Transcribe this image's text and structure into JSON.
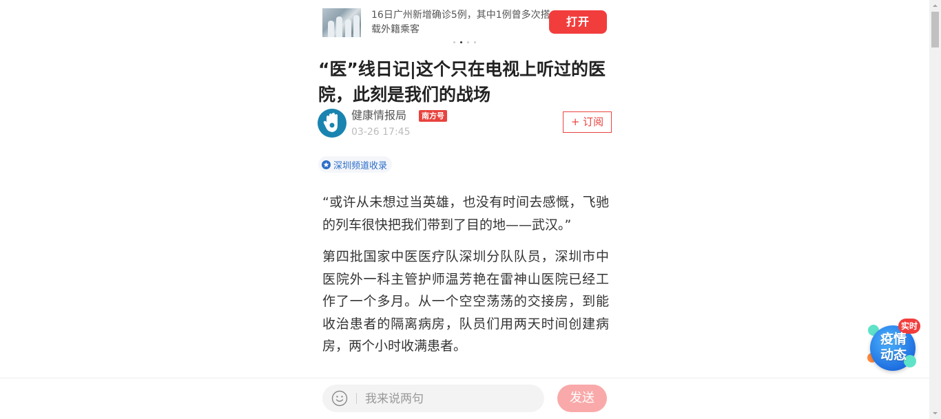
{
  "banner": {
    "text": "16日广州新增确诊5例，其中1例曾多次搭载外籍乘客",
    "open_label": "打开"
  },
  "article": {
    "title": "“医”线日记|这个只在电视上听过的医院，此刻是我们的战场",
    "author": {
      "name": "健康情报局",
      "badge": "南方号",
      "time": "03-26 17:45",
      "subscribe_label": "+ 订阅"
    },
    "channel_tag": "深圳频道收录",
    "paragraphs": [
      "“或许从未想过当英雄，也没有时间去感慨，飞驰的列车很快把我们带到了目的地——武汉。”",
      "第四批国家中医医疗队深圳分队队员，深圳市中医院外一科主管护师温芳艳在雷神山医院已经工作了一个多月。从一个空空荡荡的交接房，到能收治患者的隔离病房，队员们用两天时间创建病房，两个小时收满患者。"
    ]
  },
  "comment_bar": {
    "placeholder": "我来说两句",
    "send_label": "发送"
  },
  "widget": {
    "live_label": "实时",
    "title": "疫情动态"
  },
  "colors": {
    "accent_red": "#f23d3d",
    "link_blue": "#2d6ec9",
    "send_disabled": "#f9a9a9"
  },
  "icons": [
    "smile-icon",
    "star-icon",
    "hand-logo-icon"
  ]
}
